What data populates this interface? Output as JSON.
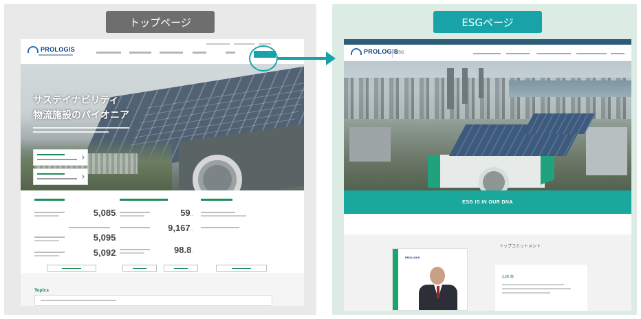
{
  "labels": {
    "left": "トップページ",
    "right": "ESGページ"
  },
  "colors": {
    "accent": "#17a3a8",
    "label_gray": "#6e6e6e",
    "left_bg": "#e9e9e9",
    "right_bg": "#dcece5",
    "brand_green": "#1b8e5a"
  },
  "left_page": {
    "logo_text": "PROLOGIS",
    "hero_title_lines": [
      "サステイナビリティ",
      "物流施設のパイオニア"
    ],
    "stats": {
      "values": [
        "5,085",
        "5,095",
        "5,092",
        "59",
        "9,167",
        "98.8"
      ]
    },
    "topics_title": "Topics"
  },
  "right_page": {
    "logo_text": "PROLOGIS",
    "section_tag": "ESG",
    "band_text": "ESG IS IN OUR DNA",
    "photo_logo": "PROLOGIS",
    "message_title": "トップコミットメント",
    "message_name": "山田 御"
  },
  "icons": {
    "arrow": "right-arrow-icon",
    "highlight": "highlight-circle-icon"
  }
}
